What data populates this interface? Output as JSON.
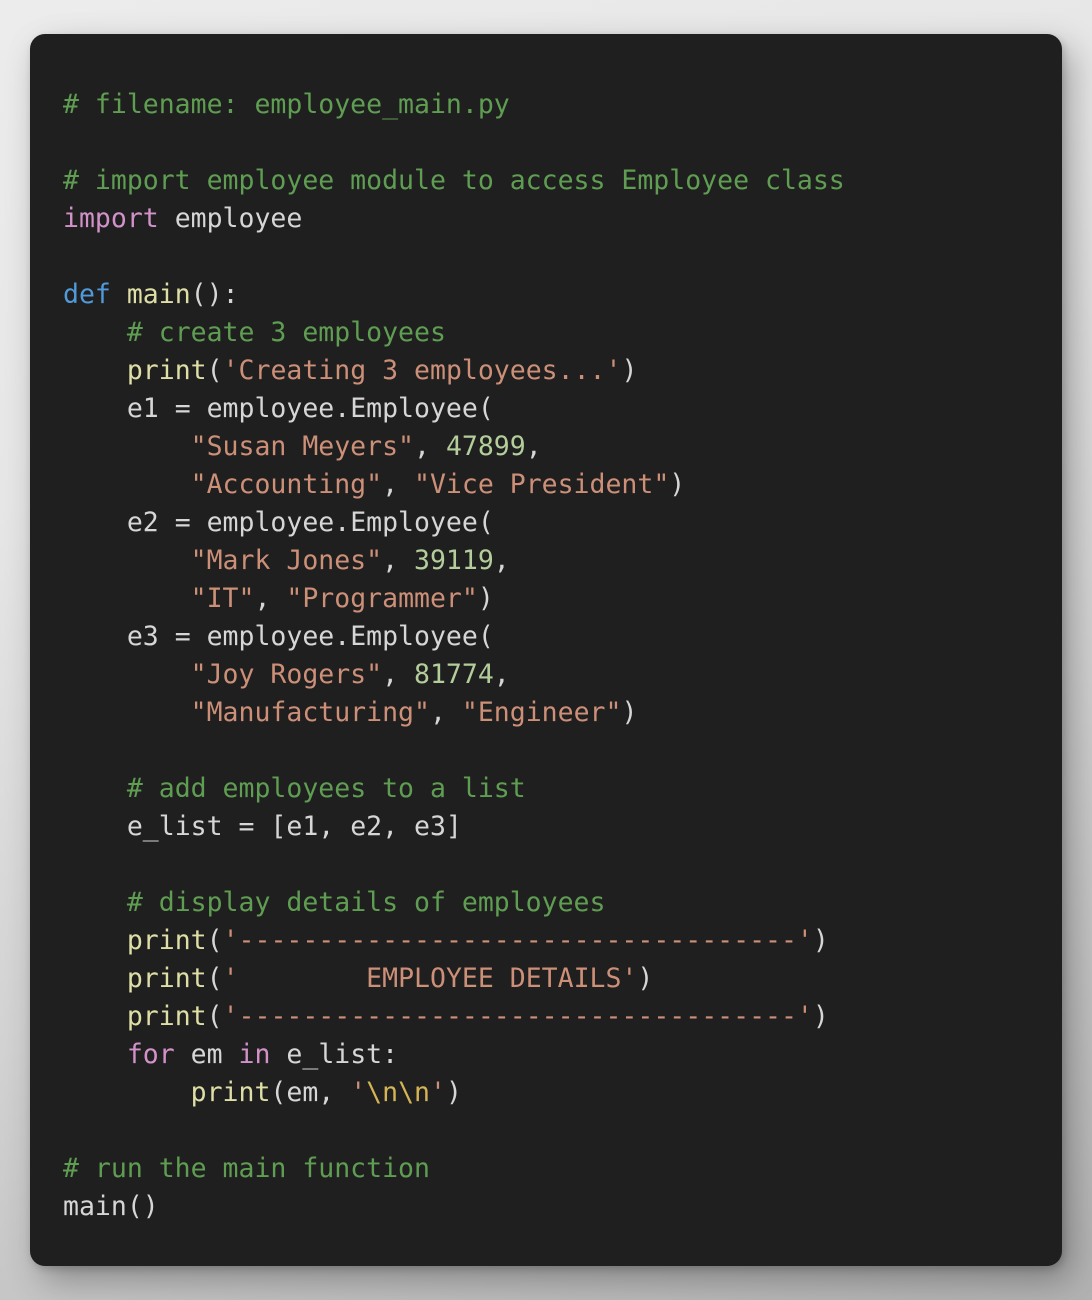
{
  "card": {
    "background": "#1f1f1f",
    "radius_px": 15
  },
  "page": {
    "background_from": "#ececec",
    "background_to": "#b2b2b2"
  },
  "theme": {
    "comment": "#5f9e52",
    "keyword": "#d292c9",
    "def_keyword": "#509ada",
    "function_name": "#dedea6",
    "plain": "#d6d6d6",
    "string": "#cc8f78",
    "number": "#b3cd9b",
    "escape": "#d4b455"
  },
  "code": {
    "language": "python",
    "filename": "employee_main.py",
    "lines": [
      {
        "indent": 0,
        "tokens": [
          {
            "t": "comment",
            "v": "# filename: employee_main.py"
          }
        ]
      },
      {
        "indent": 0,
        "tokens": []
      },
      {
        "indent": 0,
        "tokens": [
          {
            "t": "comment",
            "v": "# import employee module to access Employee class"
          }
        ]
      },
      {
        "indent": 0,
        "tokens": [
          {
            "t": "kw",
            "v": "import"
          },
          {
            "t": "plain",
            "v": " employee"
          }
        ]
      },
      {
        "indent": 0,
        "tokens": []
      },
      {
        "indent": 0,
        "tokens": [
          {
            "t": "def",
            "v": "def"
          },
          {
            "t": "plain",
            "v": " "
          },
          {
            "t": "fn",
            "v": "main"
          },
          {
            "t": "plain",
            "v": "():"
          }
        ]
      },
      {
        "indent": 1,
        "tokens": [
          {
            "t": "comment",
            "v": "# create 3 employees"
          }
        ]
      },
      {
        "indent": 1,
        "tokens": [
          {
            "t": "fn",
            "v": "print"
          },
          {
            "t": "plain",
            "v": "("
          },
          {
            "t": "str",
            "v": "'Creating 3 employees...'"
          },
          {
            "t": "plain",
            "v": ")"
          }
        ]
      },
      {
        "indent": 1,
        "tokens": [
          {
            "t": "plain",
            "v": "e1 = employee.Employee("
          }
        ]
      },
      {
        "indent": 2,
        "tokens": [
          {
            "t": "str",
            "v": "\"Susan Meyers\""
          },
          {
            "t": "plain",
            "v": ", "
          },
          {
            "t": "num",
            "v": "47899"
          },
          {
            "t": "plain",
            "v": ","
          }
        ]
      },
      {
        "indent": 2,
        "tokens": [
          {
            "t": "str",
            "v": "\"Accounting\""
          },
          {
            "t": "plain",
            "v": ", "
          },
          {
            "t": "str",
            "v": "\"Vice President\""
          },
          {
            "t": "plain",
            "v": ")"
          }
        ]
      },
      {
        "indent": 1,
        "tokens": [
          {
            "t": "plain",
            "v": "e2 = employee.Employee("
          }
        ]
      },
      {
        "indent": 2,
        "tokens": [
          {
            "t": "str",
            "v": "\"Mark Jones\""
          },
          {
            "t": "plain",
            "v": ", "
          },
          {
            "t": "num",
            "v": "39119"
          },
          {
            "t": "plain",
            "v": ","
          }
        ]
      },
      {
        "indent": 2,
        "tokens": [
          {
            "t": "str",
            "v": "\"IT\""
          },
          {
            "t": "plain",
            "v": ", "
          },
          {
            "t": "str",
            "v": "\"Programmer\""
          },
          {
            "t": "plain",
            "v": ")"
          }
        ]
      },
      {
        "indent": 1,
        "tokens": [
          {
            "t": "plain",
            "v": "e3 = employee.Employee("
          }
        ]
      },
      {
        "indent": 2,
        "tokens": [
          {
            "t": "str",
            "v": "\"Joy Rogers\""
          },
          {
            "t": "plain",
            "v": ", "
          },
          {
            "t": "num",
            "v": "81774"
          },
          {
            "t": "plain",
            "v": ","
          }
        ]
      },
      {
        "indent": 2,
        "tokens": [
          {
            "t": "str",
            "v": "\"Manufacturing\""
          },
          {
            "t": "plain",
            "v": ", "
          },
          {
            "t": "str",
            "v": "\"Engineer\""
          },
          {
            "t": "plain",
            "v": ")"
          }
        ]
      },
      {
        "indent": 0,
        "tokens": []
      },
      {
        "indent": 1,
        "tokens": [
          {
            "t": "comment",
            "v": "# add employees to a list"
          }
        ]
      },
      {
        "indent": 1,
        "tokens": [
          {
            "t": "plain",
            "v": "e_list = [e1, e2, e3]"
          }
        ]
      },
      {
        "indent": 0,
        "tokens": []
      },
      {
        "indent": 1,
        "tokens": [
          {
            "t": "comment",
            "v": "# display details of employees"
          }
        ]
      },
      {
        "indent": 1,
        "tokens": [
          {
            "t": "fn",
            "v": "print"
          },
          {
            "t": "plain",
            "v": "("
          },
          {
            "t": "str",
            "v": "'-----------------------------------'"
          },
          {
            "t": "plain",
            "v": ")"
          }
        ]
      },
      {
        "indent": 1,
        "tokens": [
          {
            "t": "fn",
            "v": "print"
          },
          {
            "t": "plain",
            "v": "("
          },
          {
            "t": "str",
            "v": "'        EMPLOYEE DETAILS'"
          },
          {
            "t": "plain",
            "v": ")"
          }
        ]
      },
      {
        "indent": 1,
        "tokens": [
          {
            "t": "fn",
            "v": "print"
          },
          {
            "t": "plain",
            "v": "("
          },
          {
            "t": "str",
            "v": "'-----------------------------------'"
          },
          {
            "t": "plain",
            "v": ")"
          }
        ]
      },
      {
        "indent": 1,
        "tokens": [
          {
            "t": "kw",
            "v": "for"
          },
          {
            "t": "plain",
            "v": " em "
          },
          {
            "t": "kw",
            "v": "in"
          },
          {
            "t": "plain",
            "v": " e_list:"
          }
        ]
      },
      {
        "indent": 2,
        "tokens": [
          {
            "t": "fn",
            "v": "print"
          },
          {
            "t": "plain",
            "v": "(em, "
          },
          {
            "t": "str",
            "v": "'"
          },
          {
            "t": "esc",
            "v": "\\n\\n"
          },
          {
            "t": "str",
            "v": "'"
          },
          {
            "t": "plain",
            "v": ")"
          }
        ]
      },
      {
        "indent": 0,
        "tokens": []
      },
      {
        "indent": 0,
        "tokens": [
          {
            "t": "comment",
            "v": "# run the main function"
          }
        ]
      },
      {
        "indent": 0,
        "tokens": [
          {
            "t": "plain",
            "v": "main()"
          }
        ]
      }
    ]
  }
}
